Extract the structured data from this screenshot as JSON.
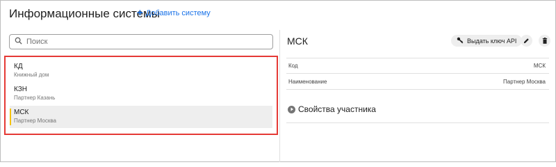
{
  "header": {
    "title": "Информационные системы",
    "add_label": "Добавить систему"
  },
  "search": {
    "placeholder": "Поиск",
    "value": ""
  },
  "systems": [
    {
      "name": "КД",
      "subtitle": "Книжный дом"
    },
    {
      "name": "КЗН",
      "subtitle": "Партнер Казань"
    },
    {
      "name": "МСК",
      "subtitle": "Партнер Москва"
    }
  ],
  "selected_index": 2,
  "detail": {
    "title": "МСК",
    "api_label": "Выдать ключ API",
    "fields": [
      {
        "label": "Код",
        "value": "МСК"
      },
      {
        "label": "Наименование",
        "value": "Партнер Москва"
      }
    ],
    "section_label": "Свойства участника"
  },
  "colors": {
    "accent": "#1a73e8",
    "highlight_border": "#e53935",
    "selected_marker": "#f4c20d"
  }
}
